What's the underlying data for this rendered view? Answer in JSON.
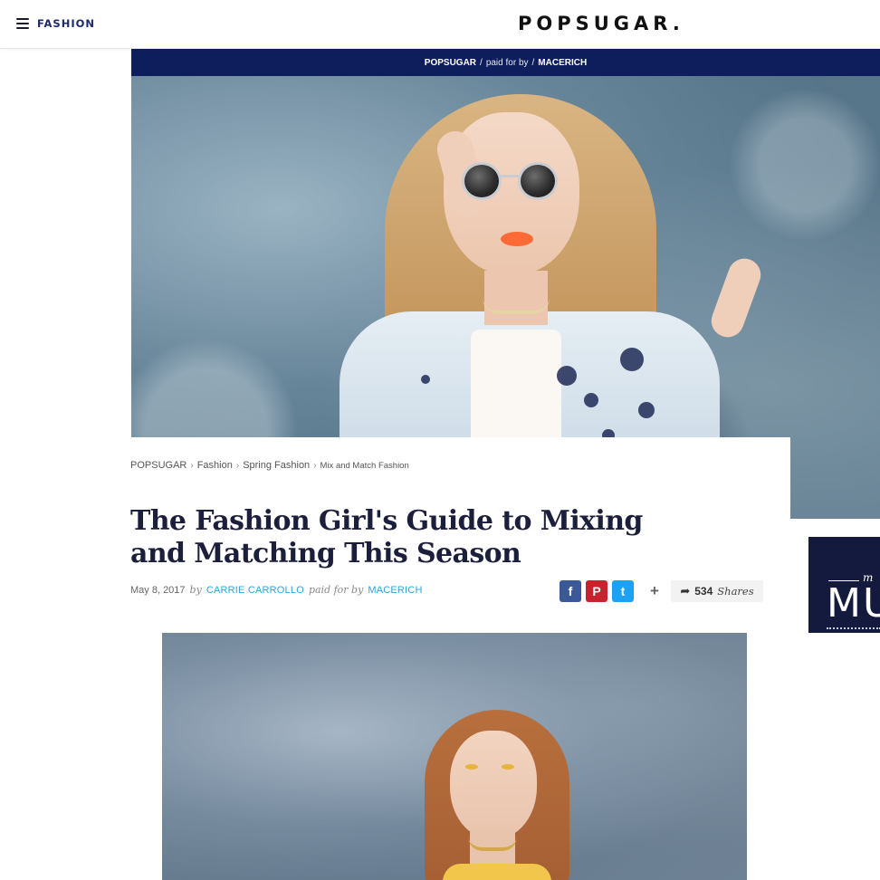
{
  "nav": {
    "section": "FASHION",
    "logo": "POPSUGAR."
  },
  "sponsor_bar": {
    "brand": "POPSUGAR",
    "sep1": "/",
    "paid_for_by": "paid for by",
    "sep2": "/",
    "sponsor": "MACERICH"
  },
  "breadcrumb": {
    "items": [
      "POPSUGAR",
      "Fashion",
      "Spring Fashion",
      "Mix and Match Fashion"
    ],
    "separator": "›"
  },
  "article": {
    "headline": "The Fashion Girl's Guide to Mixing and Matching This Season",
    "date": "May 8, 2017",
    "by": "by",
    "author": "CARRIE CARROLLO",
    "paid_for_by": "paid for by",
    "sponsor": "MACERICH"
  },
  "social": {
    "facebook": "f",
    "pinterest": "P",
    "twitter": "t",
    "more": "+",
    "share_count": "534",
    "share_label": "Shares"
  },
  "ad": {
    "script": "m",
    "big_text": "MU"
  },
  "colors": {
    "nav_accent": "#1d2a6b",
    "sponsor_bar": "#0e1d5c",
    "link": "#2aa6d8",
    "facebook": "#3b5998",
    "pinterest": "#c8232c",
    "twitter": "#1da1f2",
    "ad_bg": "#141a3e"
  },
  "icons": {
    "menu": "hamburger-icon",
    "share": "share-arrow-icon"
  }
}
